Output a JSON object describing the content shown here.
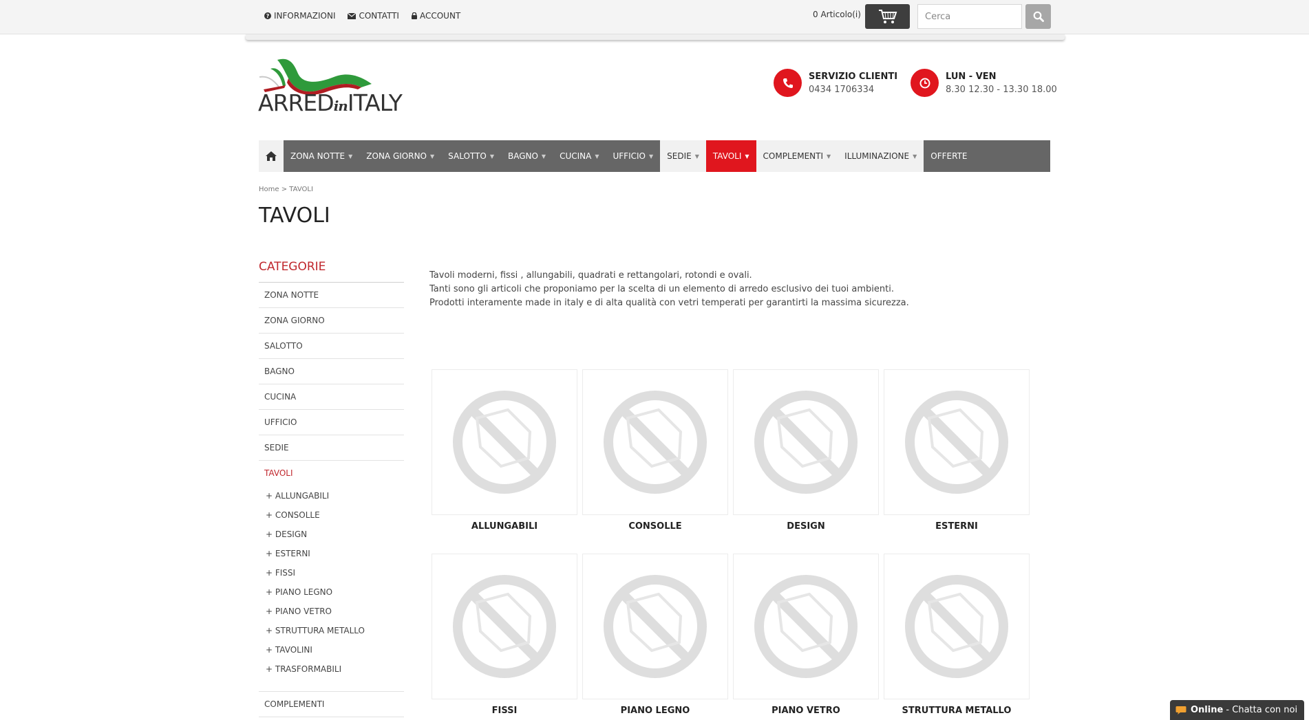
{
  "topbar": {
    "links": [
      {
        "icon": "question-circle-icon",
        "label": "INFORMAZIONI"
      },
      {
        "icon": "envelope-icon",
        "label": "CONTATTI"
      },
      {
        "icon": "lock-icon",
        "label": "ACCOUNT"
      }
    ],
    "cart_count": "0 Articolo(i)",
    "search_placeholder": "Cerca"
  },
  "header": {
    "logo_text_left": "ARRED",
    "logo_text_in": "in",
    "logo_text_right": "ITALY",
    "service_title": "SERVIZIO CLIENTI",
    "service_phone": "0434 1706334",
    "hours_title": "LUN - VEN",
    "hours_value": "8.30 12.30 - 13.30 18.00"
  },
  "nav": {
    "items": [
      {
        "label": "ZONA NOTTE",
        "caret": "▼"
      },
      {
        "label": "ZONA GIORNO",
        "caret": "▼"
      },
      {
        "label": "SALOTTO",
        "caret": "▼"
      },
      {
        "label": "BAGNO",
        "caret": "▼"
      },
      {
        "label": "CUCINA",
        "caret": "▼"
      },
      {
        "label": "UFFICIO",
        "caret": "▼"
      },
      {
        "label": "SEDIE",
        "caret": "▼"
      },
      {
        "label": "TAVOLI",
        "caret": "▼"
      },
      {
        "label": "COMPLEMENTI",
        "caret": "▼"
      },
      {
        "label": "ILLUMINAZIONE",
        "caret": "▼"
      },
      {
        "label": "OFFERTE"
      }
    ]
  },
  "breadcrumb": {
    "home": "Home",
    "separator": ">",
    "current": "TAVOLI"
  },
  "page": {
    "title": "TAVOLI"
  },
  "sidebar": {
    "title": "CATEGORIE",
    "categories_top": [
      "ZONA NOTTE",
      "ZONA GIORNO",
      "SALOTTO",
      "BAGNO",
      "CUCINA",
      "UFFICIO",
      "SEDIE"
    ],
    "active": "TAVOLI",
    "subcategories": [
      "+ ALLUNGABILI",
      "+ CONSOLLE",
      "+ DESIGN",
      "+ ESTERNI",
      "+ FISSI",
      "+ PIANO LEGNO",
      "+ PIANO VETRO",
      "+ STRUTTURA METALLO",
      "+ TAVOLINI",
      "+ TRASFORMABILI"
    ],
    "categories_bottom": [
      "COMPLEMENTI"
    ]
  },
  "description": [
    "Tavoli moderni, fissi , allungabili, quadrati e rettangolari, rotondi e ovali.",
    "Tanti sono gli articoli che proponiamo per la scelta di un elemento di arredo esclusivo dei tuoi ambienti.",
    "Prodotti interamente made in italy e di alta qualità con vetri temperati per garantirti la massima sicurezza."
  ],
  "products": [
    "ALLUNGABILI",
    "CONSOLLE",
    "DESIGN",
    "ESTERNI",
    "FISSI",
    "PIANO LEGNO",
    "PIANO VETRO",
    "STRUTTURA METALLO"
  ],
  "chat": {
    "status": "Online",
    "text": " - Chatta con noi"
  },
  "colors": {
    "accent": "#e0161e",
    "nav": "#666666",
    "category_title": "#c0272d"
  }
}
